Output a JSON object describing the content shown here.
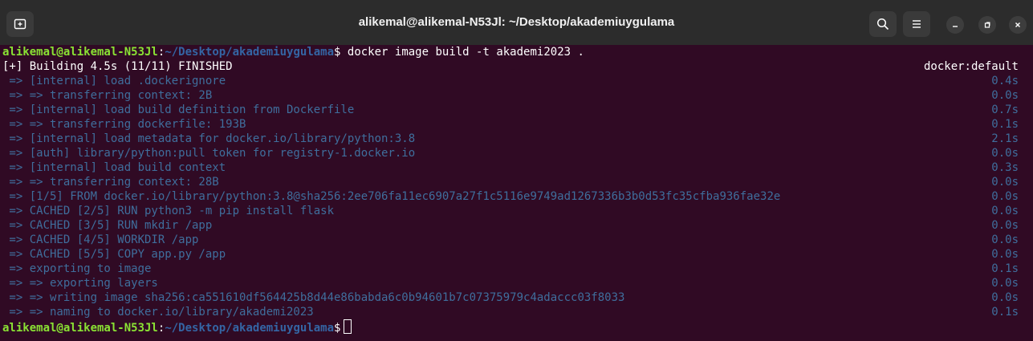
{
  "window": {
    "title": "alikemal@alikemal-N53Jl: ~/Desktop/akademiuygulama",
    "icons": {
      "new_tab": "new-tab-icon",
      "search": "search-icon",
      "menu": "hamburger-menu-icon",
      "minimize": "minimize-icon",
      "maximize": "maximize-icon",
      "close": "close-icon"
    }
  },
  "prompt": {
    "user": "alikemal@alikemal-N53Jl",
    "separator": ":",
    "path": "~/Desktop/akademiuygulama",
    "symbol": "$"
  },
  "command": " docker image build -t akademi2023 .",
  "header": {
    "left": "[+] Building 4.5s (11/11) FINISHED",
    "right": "docker:default"
  },
  "steps": [
    {
      "text": " => [internal] load .dockerignore",
      "time": "0.4s"
    },
    {
      "text": " => => transferring context: 2B",
      "time": "0.0s"
    },
    {
      "text": " => [internal] load build definition from Dockerfile",
      "time": "0.7s"
    },
    {
      "text": " => => transferring dockerfile: 193B",
      "time": "0.1s"
    },
    {
      "text": " => [internal] load metadata for docker.io/library/python:3.8",
      "time": "2.1s"
    },
    {
      "text": " => [auth] library/python:pull token for registry-1.docker.io",
      "time": "0.0s"
    },
    {
      "text": " => [internal] load build context",
      "time": "0.3s"
    },
    {
      "text": " => => transferring context: 28B",
      "time": "0.0s"
    },
    {
      "text": " => [1/5] FROM docker.io/library/python:3.8@sha256:2ee706fa11ec6907a27f1c5116e9749ad1267336b3b0d53fc35cfba936fae32e",
      "time": "0.0s"
    },
    {
      "text": " => CACHED [2/5] RUN python3 -m pip install flask",
      "time": "0.0s"
    },
    {
      "text": " => CACHED [3/5] RUN mkdir /app",
      "time": "0.0s"
    },
    {
      "text": " => CACHED [4/5] WORKDIR /app",
      "time": "0.0s"
    },
    {
      "text": " => CACHED [5/5] COPY app.py /app",
      "time": "0.0s"
    },
    {
      "text": " => exporting to image",
      "time": "0.1s"
    },
    {
      "text": " => => exporting layers",
      "time": "0.0s"
    },
    {
      "text": " => => writing image sha256:ca551610df564425b8d44e86babda6c0b94601b7c07375979c4adaccc03f8033",
      "time": "0.0s"
    },
    {
      "text": " => => naming to docker.io/library/akademi2023",
      "time": "0.1s"
    }
  ],
  "colors": {
    "background": "#300a24",
    "titlebar": "#2c2c2c",
    "prompt_user": "#8ae234",
    "prompt_path": "#3465a4",
    "dim_output": "#3f6e9c",
    "text": "#ffffff"
  }
}
